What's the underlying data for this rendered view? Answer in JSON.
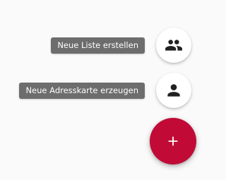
{
  "speed_dial": {
    "actions": [
      {
        "label": "Neue Liste erstellen",
        "icon": "group-icon"
      },
      {
        "label": "Neue Adresskarte erzeugen",
        "icon": "person-icon"
      }
    ],
    "main_button_icon": "plus-icon"
  },
  "colors": {
    "background": "#fafafa",
    "label_bg": "#6d6d6d",
    "label_text": "#ffffff",
    "main_fab": "#c10b36",
    "icon": "#212121"
  }
}
